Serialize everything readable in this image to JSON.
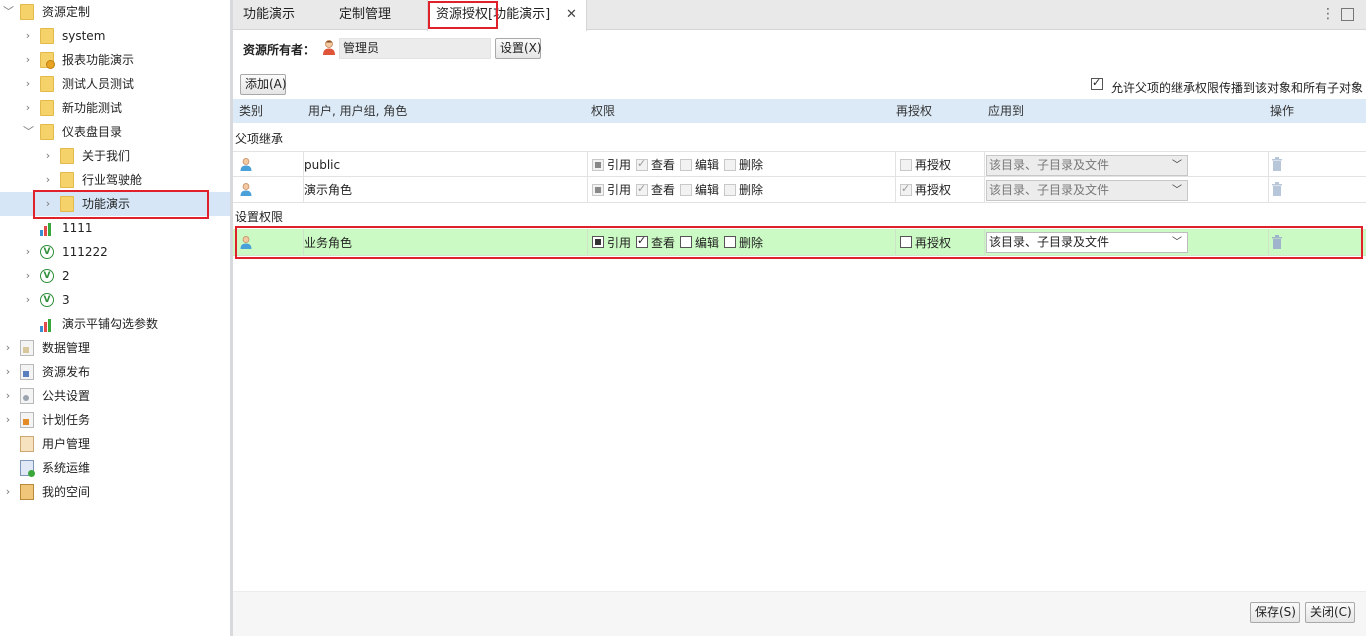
{
  "sidebar": {
    "items": [
      {
        "label": "资源定制",
        "icon": "folder-icon"
      },
      {
        "label": "system",
        "icon": "folder-icon"
      },
      {
        "label": "报表功能演示",
        "icon": "locked-folder-icon"
      },
      {
        "label": "测试人员测试",
        "icon": "folder-icon"
      },
      {
        "label": "新功能测试",
        "icon": "folder-icon"
      },
      {
        "label": "仪表盘目录",
        "icon": "folder-icon"
      },
      {
        "label": "关于我们",
        "icon": "folder-icon"
      },
      {
        "label": "行业驾驶舱",
        "icon": "folder-icon"
      },
      {
        "label": "功能演示",
        "icon": "folder-icon"
      },
      {
        "label": "1111",
        "icon": "chart-icon"
      },
      {
        "label": "111222",
        "icon": "v-icon"
      },
      {
        "label": "2",
        "icon": "v-icon"
      },
      {
        "label": "3",
        "icon": "v-icon"
      },
      {
        "label": "演示平铺勾选参数",
        "icon": "chart-icon"
      },
      {
        "label": "数据管理",
        "icon": "data-manage-icon"
      },
      {
        "label": "资源发布",
        "icon": "publish-icon"
      },
      {
        "label": "公共设置",
        "icon": "settings-icon"
      },
      {
        "label": "计划任务",
        "icon": "schedule-icon"
      },
      {
        "label": "用户管理",
        "icon": "user-manage-icon"
      },
      {
        "label": "系统运维",
        "icon": "monitor-icon"
      },
      {
        "label": "我的空间",
        "icon": "my-space-icon"
      }
    ]
  },
  "tabs": [
    {
      "label": "功能演示"
    },
    {
      "label": "定制管理"
    },
    {
      "label": "资源授权[功能演示]"
    }
  ],
  "owner": {
    "label": "资源所有者：",
    "value": "管理员",
    "set_button": "设置(X)"
  },
  "toolbar": {
    "add_button": "添加(A)",
    "propagate_label": "允许父项的继承权限传播到该对象和所有子对象",
    "propagate_checked": true
  },
  "table": {
    "headers": {
      "type": "类别",
      "principal": "用户, 用户组, 角色",
      "permission": "权限",
      "regrant": "再授权",
      "apply_to": "应用到",
      "action": "操作"
    },
    "permission_labels": {
      "ref": "引用",
      "view": "查看",
      "edit": "编辑",
      "delete": "删除",
      "regrant": "再授权"
    },
    "sections": [
      {
        "label": "父项继承",
        "rows": [
          {
            "name": "public",
            "ref": true,
            "view": true,
            "edit": false,
            "delete": false,
            "regrant": false,
            "apply_to": "该目录、子目录及文件",
            "editable": false
          },
          {
            "name": "演示角色",
            "ref": true,
            "view": true,
            "edit": false,
            "delete": false,
            "regrant": true,
            "apply_to": "该目录、子目录及文件",
            "editable": false
          }
        ]
      },
      {
        "label": "设置权限",
        "rows": [
          {
            "name": "业务角色",
            "ref": true,
            "view": true,
            "edit": false,
            "delete": false,
            "regrant": false,
            "apply_to": "该目录、子目录及文件",
            "editable": true
          }
        ]
      }
    ]
  },
  "footer": {
    "save_button": "保存(S)",
    "close_button": "关闭(C)"
  },
  "colors": {
    "highlight_row": "#ccfac4",
    "annotation_red": "#e0202a",
    "header_bg": "#dceaf7",
    "selected_tree": "#d6e6f6"
  }
}
